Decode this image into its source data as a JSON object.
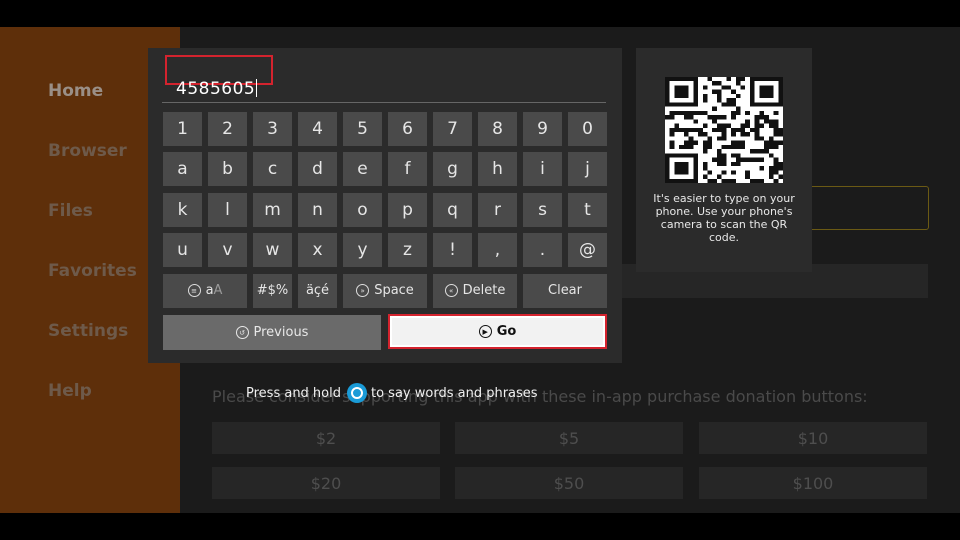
{
  "sidebar": {
    "items": [
      "Home",
      "Browser",
      "Files",
      "Favorites",
      "Settings",
      "Help"
    ]
  },
  "donations": {
    "text": "Please consider supporting this app with these in-app purchase donation buttons:",
    "amounts": [
      "$2",
      "$5",
      "$10",
      "$20",
      "$50",
      "$100"
    ]
  },
  "keyboard": {
    "input_value": "4585605",
    "keys": [
      "1",
      "2",
      "3",
      "4",
      "5",
      "6",
      "7",
      "8",
      "9",
      "0",
      "a",
      "b",
      "c",
      "d",
      "e",
      "f",
      "g",
      "h",
      "i",
      "j",
      "k",
      "l",
      "m",
      "n",
      "o",
      "p",
      "q",
      "r",
      "s",
      "t",
      "u",
      "v",
      "w",
      "x",
      "y",
      "z",
      "!",
      ",",
      ".",
      "@"
    ],
    "special": {
      "case_label_a": "a",
      "case_label_b": "A",
      "symbols": "#$%",
      "accents": "äçé",
      "space": "Space",
      "delete": "Delete",
      "clear": "Clear"
    },
    "previous": "Previous",
    "go": "Go"
  },
  "qr": {
    "caption": "It's easier to type on your phone. Use your phone's camera to scan the QR code."
  },
  "hint": {
    "before": "Press and hold",
    "after": "to say words and phrases",
    "mic_color": "#1a9bd7"
  },
  "colors": {
    "focus_border": "#d4232e",
    "sidebar": "#5e2f0a"
  }
}
